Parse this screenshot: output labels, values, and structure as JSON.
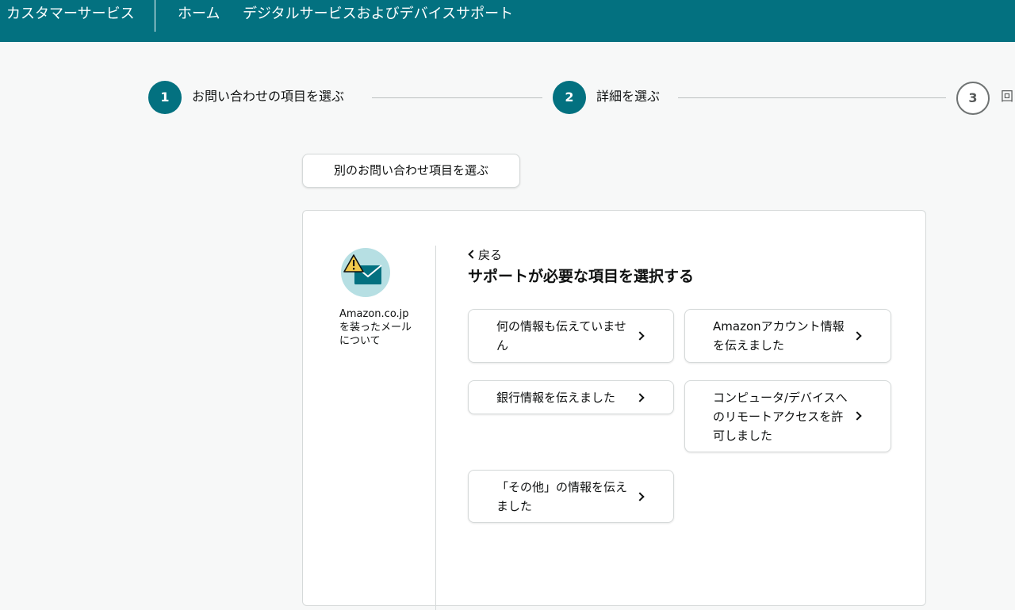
{
  "header": {
    "brand": "カスタマーサービス",
    "nav": [
      "ホーム",
      "デジタルサービスおよびデバイスサポート"
    ]
  },
  "steps": [
    {
      "number": "1",
      "label": "お問い合わせの項目を選ぶ",
      "state": "complete"
    },
    {
      "number": "2",
      "label": "詳細を選ぶ",
      "state": "current"
    },
    {
      "number": "3",
      "label": "回",
      "state": "upcoming"
    }
  ],
  "other_topic_button": "別のお問い合わせ項目を選ぶ",
  "topic": {
    "icon": "warning-envelope-icon",
    "label": "Amazon.co.jp を装ったメール について"
  },
  "back_label": "戻る",
  "section_title": "サポートが必要な項目を選択する",
  "options": [
    "何の情報も伝えていません",
    "Amazonアカウント情報を伝えました",
    "銀行情報を伝えました",
    "コンピュータ/デバイスへのリモートアクセスを許可しました",
    "「その他」の情報を伝えました"
  ],
  "colors": {
    "header_bg": "#037180",
    "step_active": "#037180",
    "page_bg": "#f7f8f8",
    "icon_circle": "#b6dfe3",
    "warning_yellow": "#f2c94c"
  }
}
